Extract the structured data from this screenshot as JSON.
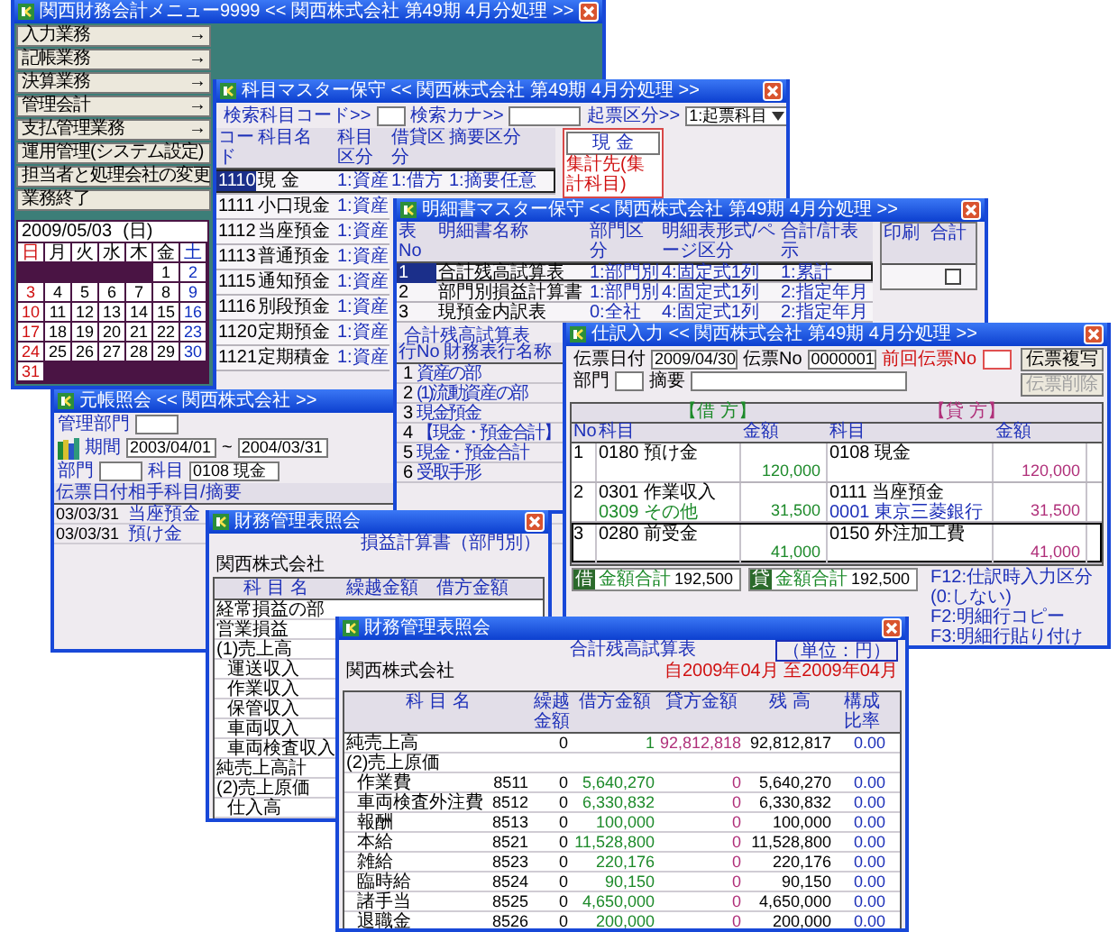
{
  "windows": [
    {
      "kind": "menu",
      "title": "関西財務会計メニュー9999 << 関西株式会社 第49期 4月分処理 >>",
      "menu_buttons": [
        {
          "label": "入力業務",
          "arrow": "→"
        },
        {
          "label": "記帳業務",
          "arrow": "→"
        },
        {
          "label": "決算業務",
          "arrow": "→"
        },
        {
          "label": "管理会計",
          "arrow": "→"
        },
        {
          "label": "支払管理業務",
          "arrow": "→"
        },
        {
          "label": "運用管理(システム設定)"
        },
        {
          "label": "担当者と処理会社の変更"
        },
        {
          "label": "業務終了"
        }
      ],
      "calendar": {
        "date": "2009/05/03",
        "weekday": "(日)",
        "day_headers": [
          "日",
          "月",
          "火",
          "水",
          "木",
          "金",
          "土"
        ],
        "weeks": [
          [
            "1",
            "2"
          ],
          [
            "3",
            "4",
            "5",
            "6",
            "7",
            "8",
            "9"
          ],
          [
            "10",
            "11",
            "12",
            "13",
            "14",
            "15",
            "16"
          ],
          [
            "17",
            "18",
            "19",
            "20",
            "21",
            "22",
            "23"
          ],
          [
            "24",
            "25",
            "26",
            "27",
            "28",
            "29",
            "30"
          ],
          [
            "31"
          ]
        ]
      }
    },
    {
      "kind": "account_master",
      "title": "科目マスター保守 << 関西株式会社 第49期 4月分処理 >>",
      "search": [
        {
          "label": "検索科目コード>>"
        },
        {
          "label": "検索カナ>>"
        },
        {
          "label": "起票区分>>",
          "value": "1:起票科目"
        }
      ],
      "columns": [
        "コード",
        "科目名",
        "科目区分",
        "借貸区分",
        "摘要区分"
      ],
      "rows": [
        {
          "selected": true,
          "cells": [
            "1110",
            "現 金",
            "1:資産",
            "1:借方",
            "1:摘要任意"
          ]
        },
        {
          "selected": false,
          "cells": [
            "1111",
            "小口現金",
            "1:資産"
          ]
        },
        {
          "selected": false,
          "cells": [
            "1112",
            "当座預金",
            "1:資産"
          ]
        },
        {
          "selected": false,
          "cells": [
            "1113",
            "普通預金",
            "1:資産"
          ]
        },
        {
          "selected": false,
          "cells": [
            "1115",
            "通知預金",
            "1:資産"
          ]
        },
        {
          "selected": false,
          "cells": [
            "1116",
            "別段預金",
            "1:資産"
          ]
        },
        {
          "selected": false,
          "cells": [
            "1120",
            "定期預金",
            "1:資産"
          ]
        },
        {
          "selected": false,
          "cells": [
            "1121",
            "定期積金",
            "1:資産"
          ]
        }
      ],
      "panel": {
        "title": "現 金",
        "label": "集計先(集計科目)"
      }
    },
    {
      "kind": "statement_master",
      "title": "明細書マスター保守 << 関西株式会社 第49期 4月分処理 >>",
      "columns": [
        "表No",
        "明細書名称",
        "部門区分",
        "明細表形式/ページ区分",
        "合計/計表示"
      ],
      "rows": [
        {
          "selected": true,
          "cells": [
            "1",
            "合計残高試算表",
            "1:部門別",
            "4:固定式1列",
            "1:累計"
          ]
        },
        {
          "selected": false,
          "cells": [
            "2",
            "部門別損益計算書",
            "1:部門別",
            "4:固定式1列",
            "2:指定年月"
          ]
        },
        {
          "selected": false,
          "cells": [
            "3",
            "現預金内訳表",
            "0:全社",
            "4:固定式1列",
            "2:指定年月"
          ]
        }
      ],
      "print_columns": [
        "印刷",
        "合計"
      ],
      "total_checkbox": {
        "checked": false
      },
      "statement_label": "合計残高試算表",
      "line_columns": [
        "行No",
        "財務表行名称"
      ],
      "lines": [
        [
          "1",
          "資産の部"
        ],
        [
          "2",
          "(1)流動資産の部"
        ],
        [
          "3",
          "現金預金"
        ],
        [
          "4",
          "【現金・預金合計】"
        ],
        [
          "5",
          "現金・預金合計"
        ],
        [
          "6",
          "受取手形"
        ]
      ]
    },
    {
      "kind": "journal_entry",
      "title": "仕訳入力 << 関西株式会社 第49期 4月分処理 >>",
      "fields": [
        {
          "label": "伝票日付",
          "value": "2009/04/30",
          "kind": "normal"
        },
        {
          "label": "伝票No",
          "value": "0000001",
          "kind": "normal"
        },
        {
          "label": "前回伝票No",
          "kind": "alert"
        }
      ],
      "fields2": [
        {
          "label": "部門"
        },
        {
          "label": "摘要"
        }
      ],
      "buttons": [
        {
          "label": "伝票複写",
          "disabled": false
        },
        {
          "label": "伝票削除",
          "disabled": true
        }
      ],
      "sides": [
        "【借 方】",
        "【貸 方】"
      ],
      "columns": [
        "No",
        "科目",
        "金額",
        "科目",
        "金額"
      ],
      "entries": [
        {
          "no": "1",
          "debit_account": "0180 預け金",
          "debit_amount": "120,000",
          "credit_account": "0108 現金",
          "credit_amount": "120,000",
          "selected": false
        },
        {
          "no": "2",
          "debit_account": "0301 作業収入",
          "debit_sub": "0309 その他",
          "debit_amount": "31,500",
          "credit_account": "0111 当座預金",
          "credit_sub": "0001 東京三菱銀行",
          "credit_amount": "31,500",
          "selected": false
        },
        {
          "no": "3",
          "debit_account": "0280 前受金",
          "debit_amount": "41,000",
          "credit_account": "0150 外注加工費",
          "credit_amount": "41,000",
          "selected": true
        }
      ],
      "totals": [
        {
          "side": "借",
          "label": "金額合計",
          "amount": "192,500"
        },
        {
          "side": "貸",
          "label": "金額合計",
          "amount": "192,500"
        }
      ],
      "help": [
        "F12:仕訳時入力区分",
        "(0:しない)",
        "F2:明細行コピー",
        "F3:明細行貼り付け"
      ]
    },
    {
      "kind": "ledger",
      "title": "元帳照会 << 関西株式会社 >>",
      "field_rows": [
        [
          {
            "label": "管理部門"
          }
        ],
        [
          {
            "label": "期間",
            "value": "2003/04/01",
            "separator": "~",
            "value_to": "2004/03/31"
          }
        ],
        [
          {
            "label": "部門"
          },
          {
            "label": "科目",
            "value": "0108 現金"
          }
        ]
      ],
      "columns": [
        "伝票日付",
        "相手科目/摘要"
      ],
      "rows": [
        [
          "03/03/31",
          "当座預金"
        ],
        [
          "03/03/31",
          "預け金"
        ]
      ]
    },
    {
      "kind": "pl_report",
      "title": "財務管理表照会",
      "report_title": "損益計算書（部門別）",
      "company": "関西株式会社",
      "columns": [
        "科 目 名",
        "繰越金額",
        "借方金額"
      ],
      "rows": [
        {
          "name": "経常損益の部"
        },
        {
          "name": "営業損益"
        },
        {
          "name": "(1)売上高",
          "children": [
            {
              "name": "運送収入"
            },
            {
              "name": "作業収入"
            },
            {
              "name": "保管収入"
            },
            {
              "name": "車両収入"
            },
            {
              "name": "車両検査収入"
            }
          ]
        },
        {
          "name": "純売上高計"
        },
        {
          "name": "(2)売上原価",
          "children": [
            {
              "name": "仕入高"
            }
          ]
        }
      ]
    },
    {
      "kind": "trial_balance",
      "title": "財務管理表照会",
      "report_title": "合計残高試算表",
      "unit": "（単位：円）",
      "period": "自2009年04月 至2009年04月",
      "company": "関西株式会社",
      "columns": [
        "科 目 名",
        "繰越金額",
        "借方金額",
        "貸方金額",
        "残 高",
        "構成比率"
      ],
      "rows": [
        {
          "name": "純売上高",
          "values": [
            "0",
            "1",
            "92,812,818",
            "92,812,817",
            "0.00"
          ]
        },
        {
          "name": "(2)売上原価",
          "children": [
            {
              "name": "作業費",
              "code": "8511",
              "values": [
                "0",
                "5,640,270",
                "0",
                "5,640,270",
                "0.00"
              ]
            },
            {
              "name": "車両検査外注費",
              "code": "8512",
              "values": [
                "0",
                "6,330,832",
                "0",
                "6,330,832",
                "0.00"
              ]
            },
            {
              "name": "報酬",
              "code": "8513",
              "values": [
                "0",
                "100,000",
                "0",
                "100,000",
                "0.00"
              ]
            },
            {
              "name": "本給",
              "code": "8521",
              "values": [
                "0",
                "11,528,800",
                "0",
                "11,528,800",
                "0.00"
              ]
            },
            {
              "name": "雑給",
              "code": "8523",
              "values": [
                "0",
                "220,176",
                "0",
                "220,176",
                "0.00"
              ]
            },
            {
              "name": "臨時給",
              "code": "8524",
              "values": [
                "0",
                "90,150",
                "0",
                "90,150",
                "0.00"
              ]
            },
            {
              "name": "諸手当",
              "code": "8525",
              "values": [
                "0",
                "4,650,000",
                "0",
                "4,650,000",
                "0.00"
              ]
            },
            {
              "name": "退職金",
              "code": "8526",
              "values": [
                "0",
                "200,000",
                "0",
                "200,000",
                "0.00"
              ]
            }
          ]
        }
      ]
    }
  ]
}
